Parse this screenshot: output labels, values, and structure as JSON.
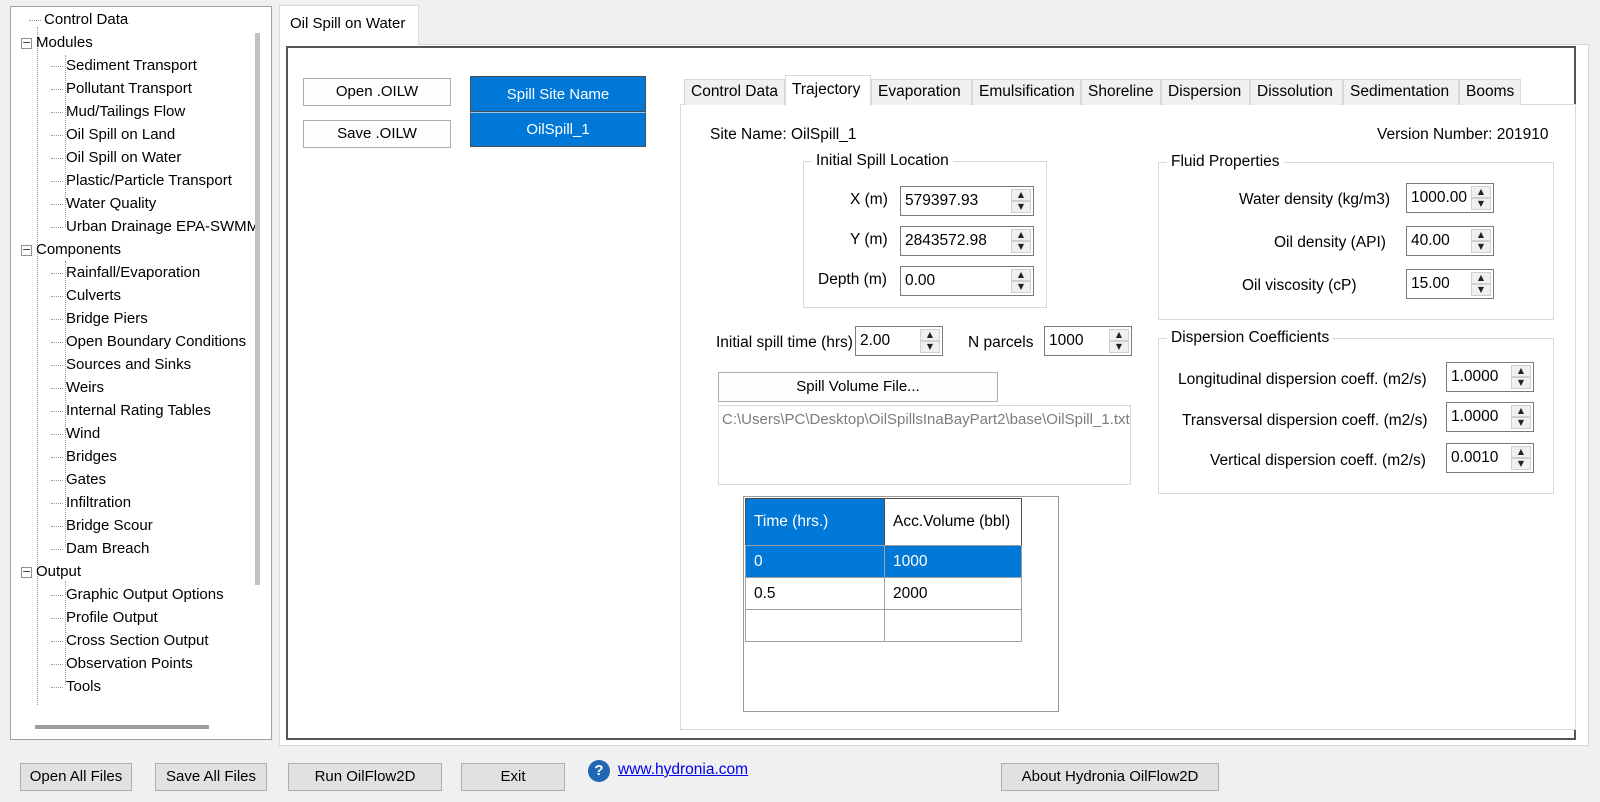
{
  "tree": {
    "roots": [
      {
        "label": "Control Data",
        "expandable": false
      },
      {
        "label": "Modules",
        "expandable": true,
        "children": [
          "Sediment Transport",
          "Pollutant Transport",
          "Mud/Tailings Flow",
          "Oil Spill on Land",
          "Oil Spill on Water",
          "Plastic/Particle Transport",
          "Water Quality",
          "Urban Drainage EPA-SWMM"
        ]
      },
      {
        "label": "Components",
        "expandable": true,
        "children": [
          "Rainfall/Evaporation",
          "Culverts",
          "Bridge Piers",
          "Open Boundary Conditions",
          "Sources and Sinks",
          "Weirs",
          "Internal Rating Tables",
          "Wind",
          "Bridges",
          "Gates",
          "Infiltration",
          "Bridge Scour",
          "Dam Breach"
        ]
      },
      {
        "label": "Output",
        "expandable": true,
        "children": [
          "Graphic Output Options",
          "Profile Output",
          "Cross Section Output",
          "Observation Points",
          "Tools"
        ]
      }
    ],
    "expander_symbol": "−"
  },
  "outer_tab": "Oil Spill on Water",
  "file_buttons": {
    "open": "Open .OILW",
    "save": "Save .OILW"
  },
  "spill_sites": {
    "header": "Spill Site Name",
    "rows": [
      "OilSpill_1"
    ]
  },
  "inner_tabs": [
    "Control Data",
    "Trajectory",
    "Evaporation",
    "Emulsification",
    "Shoreline",
    "Dispersion",
    "Dissolution",
    "Sedimentation",
    "Booms"
  ],
  "active_inner_tab": "Trajectory",
  "site_name": "Site Name: OilSpill_1",
  "version_number": "Version Number: 201910",
  "initial_spill": {
    "title": "Initial Spill Location",
    "x_label": "X (m)",
    "x_value": "579397.93",
    "y_label": "Y (m)",
    "y_value": "2843572.98",
    "depth_label": "Depth (m)",
    "depth_value": "0.00"
  },
  "fluid": {
    "title": "Fluid Properties",
    "water_density_label": "Water density (kg/m3)",
    "water_density_value": "1000.00",
    "oil_density_label": "Oil density (API)",
    "oil_density_value": "40.00",
    "oil_viscosity_label": "Oil viscosity (cP)",
    "oil_viscosity_value": "15.00"
  },
  "spill_time": {
    "label": "Initial spill time (hrs)",
    "value": "2.00"
  },
  "n_parcels": {
    "label": "N parcels",
    "value": "1000"
  },
  "spill_volume_button": "Spill Volume File...",
  "spill_volume_path": "C:\\Users\\PC\\Desktop\\OilSpillsInaBayPart2\\base\\OilSpill_1.txt",
  "dispersion": {
    "title": "Dispersion Coefficients",
    "longitudinal_label": "Longitudinal dispersion coeff. (m2/s)",
    "longitudinal_value": "1.0000",
    "transversal_label": "Transversal dispersion coeff. (m2/s)",
    "transversal_value": "1.0000",
    "vertical_label": "Vertical dispersion coeff. (m2/s)",
    "vertical_value": "0.0010"
  },
  "volume_table": {
    "headers": [
      "Time (hrs.)",
      "Acc.Volume (bbl)"
    ],
    "rows": [
      [
        "0",
        "1000"
      ],
      [
        "0.5",
        "2000"
      ],
      [
        "",
        ""
      ]
    ]
  },
  "bottom": {
    "open_all": "Open All Files",
    "save_all": "Save All Files",
    "run": "Run OilFlow2D",
    "exit": "Exit",
    "help_symbol": "?",
    "link": "www.hydronia.com",
    "about": "About Hydronia OilFlow2D"
  }
}
